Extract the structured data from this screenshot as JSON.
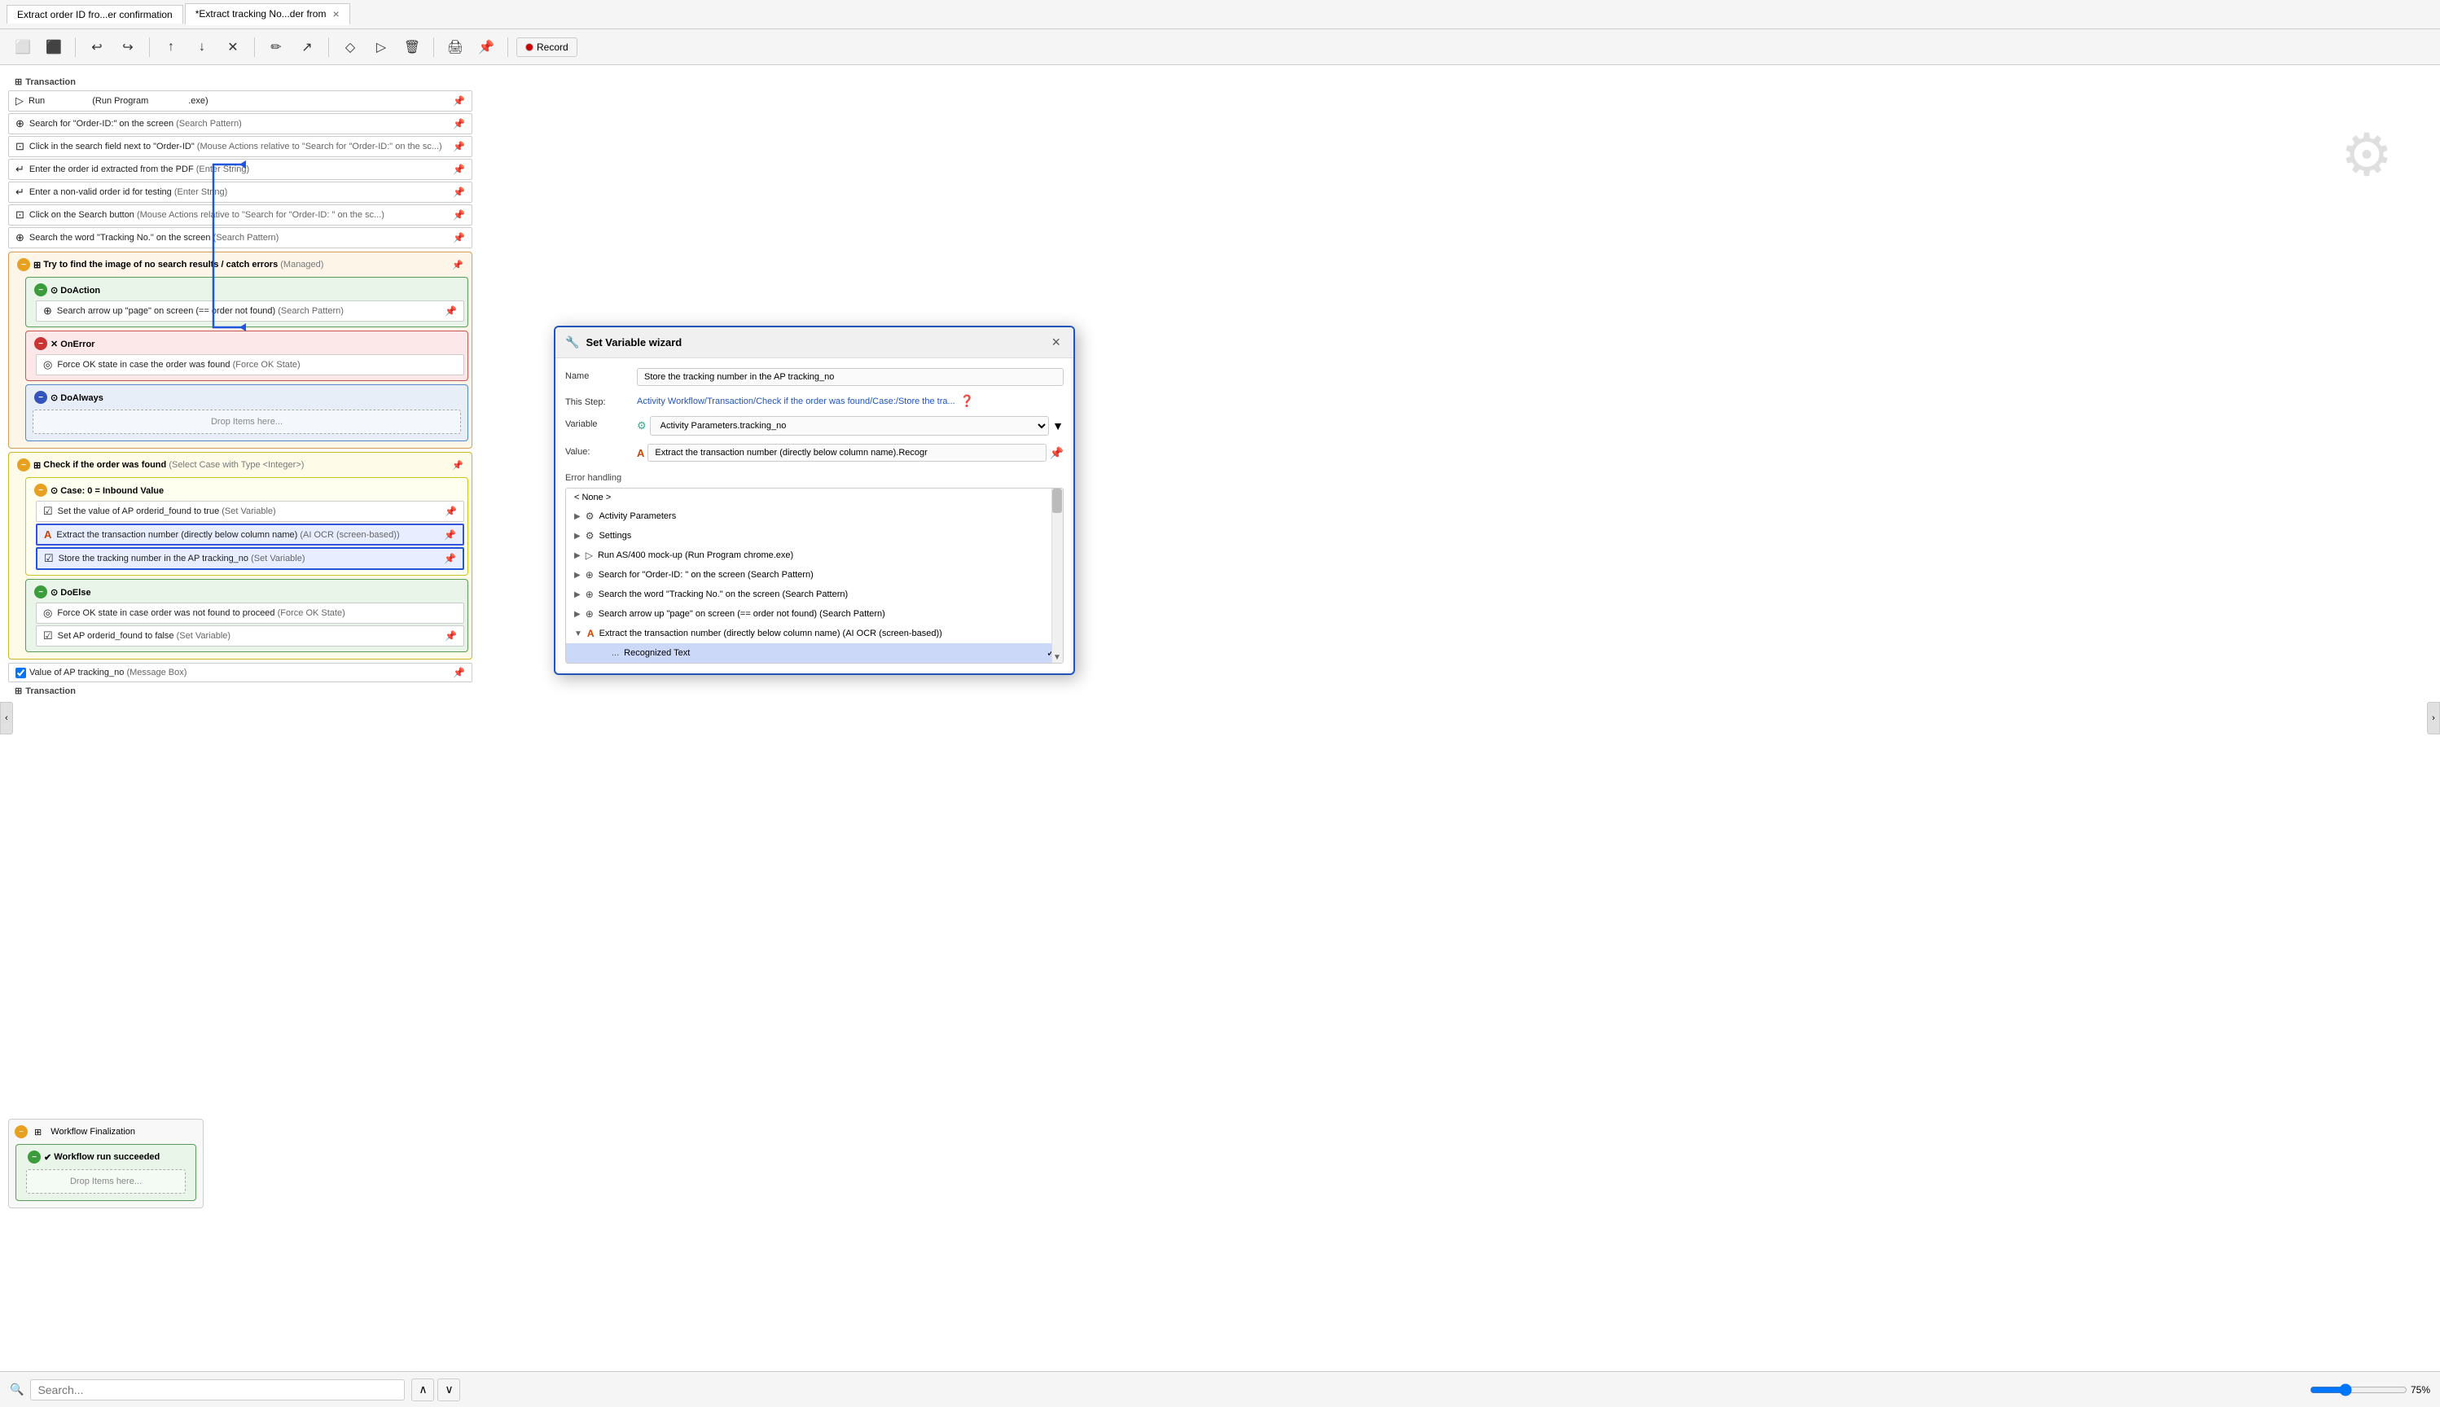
{
  "tabs": [
    {
      "id": "tab1",
      "label": "Extract order ID fro...er confirmation",
      "active": false,
      "closable": false
    },
    {
      "id": "tab2",
      "label": "*Extract tracking No...der from",
      "active": true,
      "closable": true
    }
  ],
  "toolbar": {
    "buttons": [
      "copy",
      "paste",
      "undo",
      "redo",
      "up",
      "down",
      "close",
      "wand",
      "flow",
      "diamond",
      "play",
      "trash",
      "print",
      "pin"
    ],
    "record_label": "Record"
  },
  "canvas": {
    "section_transaction_label": "Transaction",
    "items": [
      {
        "id": "run",
        "icon": "▷",
        "label": "Run",
        "detail": "(Run Program                    .exe)",
        "pin": true
      },
      {
        "id": "search_orderid",
        "icon": "⊕",
        "label": "Search for \"Order-ID:\" on the screen",
        "detail": "(Search Pattern)",
        "pin": true
      },
      {
        "id": "click_search",
        "icon": "⊡",
        "label": "Click in the search field next to \"Order-ID\"",
        "detail": "(Mouse Actions relative to \"Search for \"Order-ID:\" on the sc...)",
        "pin": true
      },
      {
        "id": "enter_order",
        "icon": "↵",
        "label": "Enter the order id extracted from the PDF",
        "detail": "(Enter String)",
        "pin": true
      },
      {
        "id": "enter_nonvalid",
        "icon": "↵",
        "label": "Enter a non-valid order id for testing",
        "detail": "(Enter String)",
        "pin": true
      },
      {
        "id": "click_search_btn",
        "icon": "⊡",
        "label": "Click on the Search button",
        "detail": "(Mouse Actions relative to \"Search for \"Order-ID:\" on the sc...)",
        "pin": true
      },
      {
        "id": "search_tracking",
        "icon": "⊕",
        "label": "Search the word \"Tracking No.\" on the screen",
        "detail": "(Search Pattern)",
        "pin": true
      }
    ],
    "try_group": {
      "label": "Try to find the image of no search results / catch errors",
      "detail": "(Managed)",
      "do_action": {
        "label": "DoAction",
        "items": [
          {
            "id": "search_arrow",
            "icon": "⊕",
            "label": "Search arrow up \"page\" on screen (== order not found)",
            "detail": "(Search Pattern)",
            "pin": true
          }
        ]
      },
      "on_error": {
        "label": "OnError",
        "items": [
          {
            "id": "force_ok",
            "icon": "◎",
            "label": "Force OK state in case the order was found",
            "detail": "(Force OK State)",
            "pin": false
          }
        ]
      },
      "do_always": {
        "label": "DoAlways",
        "drop_label": "Drop Items here..."
      }
    },
    "check_group": {
      "label": "Check if the order was found",
      "detail": "(Select Case with Type <Integer>)",
      "case_group": {
        "label": "Case: 0 = Inbound Value",
        "items": [
          {
            "id": "set_orderid_true",
            "icon": "☑",
            "label": "Set the value of AP orderid_found to true",
            "detail": "(Set Variable)",
            "pin": true
          },
          {
            "id": "extract_transaction",
            "icon": "A",
            "label": "Extract the transaction number (directly below column name)",
            "detail": "(AI OCR (screen-based))",
            "pin": true,
            "highlighted": true
          },
          {
            "id": "store_tracking",
            "icon": "☑",
            "label": "Store the tracking number in the AP tracking_no",
            "detail": "(Set Variable)",
            "pin": true,
            "highlighted": true
          }
        ]
      },
      "do_else": {
        "label": "DoElse",
        "items": [
          {
            "id": "force_ok_notfound",
            "icon": "◎",
            "label": "Force OK state in case order was not found to proceed",
            "detail": "(Force OK State)",
            "pin": false
          },
          {
            "id": "set_orderid_false",
            "icon": "☑",
            "label": "Set AP orderid_found to false",
            "detail": "(Set Variable)",
            "pin": true
          }
        ]
      }
    },
    "value_messagebox": {
      "label": "Value of AP tracking_no (Message Box)",
      "pin": true,
      "checked": true
    }
  },
  "bottom_section": {
    "transaction_label2": "Transaction",
    "workflow_finalization": {
      "label": "Workflow Finalization",
      "succeeded": {
        "label": "Workflow run succeeded",
        "drop_label": "Drop Items here..."
      }
    }
  },
  "dialog": {
    "title": "Set Variable wizard",
    "close": "×",
    "name_label": "Name",
    "name_value": "Store the tracking number in the AP tracking_no",
    "this_step_label": "This Step:",
    "this_step_value": "Activity Workflow/Transaction/Check if the order was found/Case:/Store the tra...",
    "variable_label": "Variable",
    "variable_value": "Activity Parameters.tracking_no",
    "value_label": "Value:",
    "value_value": "Extract the transaction number (directly below column name).Recogr",
    "error_handling_label": "Error handling",
    "dropdown": {
      "items": [
        {
          "id": "none",
          "label": "< None >",
          "indent": 0,
          "toggle": false,
          "icon": ""
        },
        {
          "id": "activity_params",
          "label": "Activity Parameters",
          "indent": 0,
          "toggle": true,
          "icon": "⚙"
        },
        {
          "id": "settings",
          "label": "Settings",
          "indent": 0,
          "toggle": true,
          "icon": "⚙"
        },
        {
          "id": "run_as400",
          "label": "Run AS/400 mock-up  (Run Program chrome.exe)",
          "indent": 0,
          "toggle": true,
          "icon": "▷"
        },
        {
          "id": "search_orderid_dd",
          "label": "Search for \"Order-ID: \" on the screen (Search Pattern)",
          "indent": 0,
          "toggle": true,
          "icon": "⊕"
        },
        {
          "id": "search_tracking_dd",
          "label": "Search the word \"Tracking No.\" on the screen (Search Pattern)",
          "indent": 0,
          "toggle": true,
          "icon": "⊕"
        },
        {
          "id": "search_arrow_dd",
          "label": "Search arrow up \"page\" on screen (== order not found) (Search Pattern)",
          "indent": 0,
          "toggle": true,
          "icon": "⊕"
        },
        {
          "id": "extract_ocr_dd",
          "label": "Extract the transaction number (directly below column name) (AI OCR (screen-based))",
          "indent": 0,
          "toggle": false,
          "icon": "A",
          "expanded": true
        },
        {
          "id": "recognized_text",
          "label": "Recognized Text",
          "indent": 3,
          "toggle": false,
          "icon": "...",
          "selected": true
        }
      ]
    }
  },
  "bottom_bar": {
    "search_placeholder": "Search...",
    "zoom_level": "75%",
    "nav_up": "∧",
    "nav_down": "∨"
  },
  "gear_icon": "⚙"
}
